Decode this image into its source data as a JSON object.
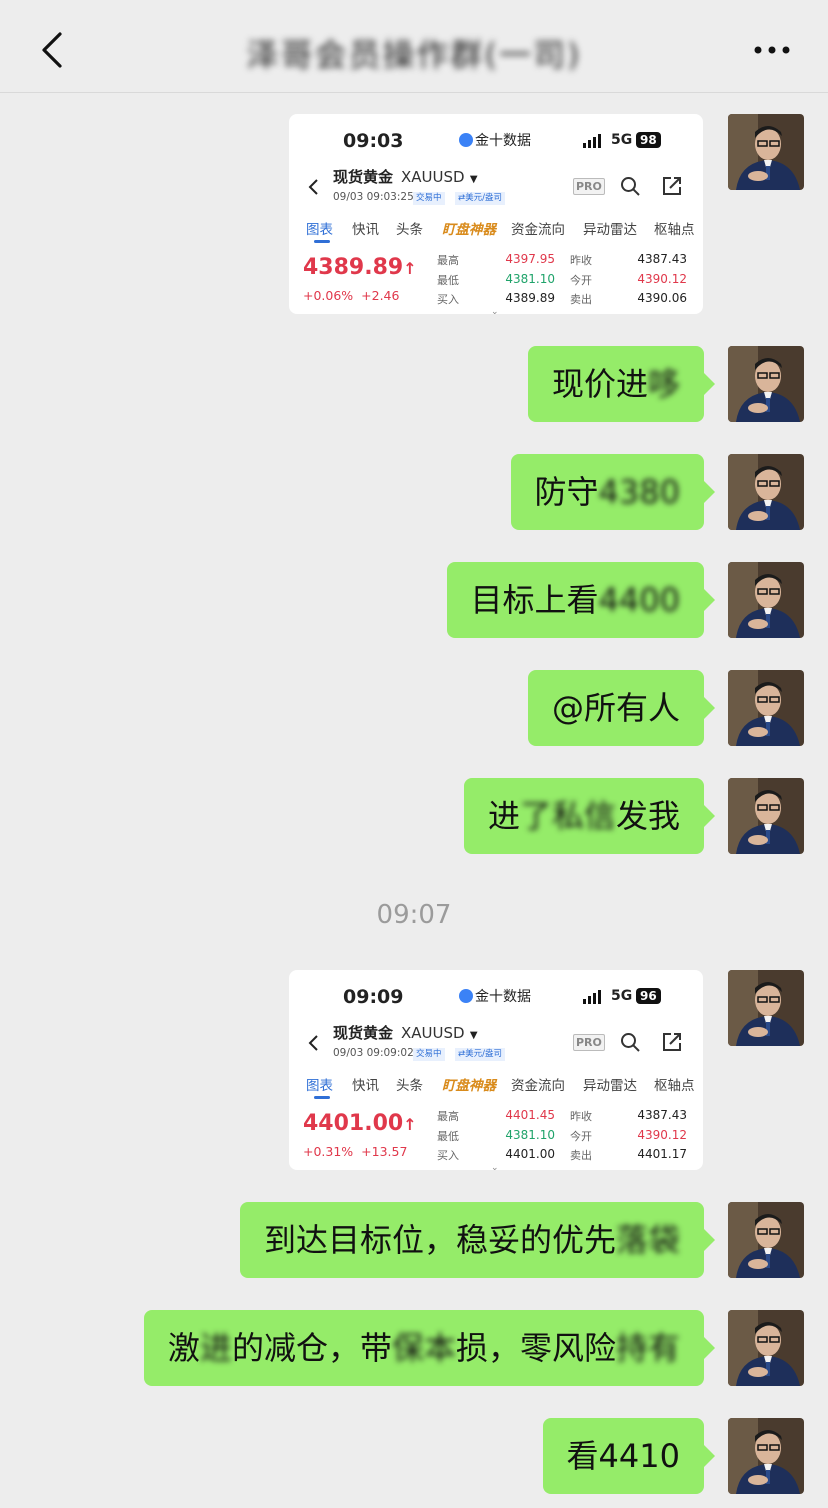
{
  "header": {
    "title": "泽哥会员操作群(一司)"
  },
  "screenshots": [
    {
      "time": "09:03",
      "brand": "金十数据",
      "network": "5G",
      "battery": "98",
      "name": "现货黄金",
      "symbol": "XAUUSD",
      "datetime": "09/03 09:03:25",
      "status_tag": "交易中",
      "currency_tag": "⇄美元/盎司",
      "pro": "PRO",
      "tabs": [
        "图表",
        "快讯",
        "头条",
        "盯盘神器",
        "资金流向",
        "异动雷达",
        "枢轴点"
      ],
      "price": "4389.89",
      "arrow": "↑",
      "change_pct": "+0.06%",
      "change": "+2.46",
      "stats": [
        {
          "label": "最高",
          "value": "4397.95",
          "color": "red"
        },
        {
          "label": "最低",
          "value": "4381.10",
          "color": "green"
        },
        {
          "label": "买入",
          "value": "4389.89",
          "color": "dark"
        },
        {
          "label": "昨收",
          "value": "4387.43",
          "color": "dark"
        },
        {
          "label": "今开",
          "value": "4390.12",
          "color": "red"
        },
        {
          "label": "卖出",
          "value": "4390.06",
          "color": "dark"
        }
      ]
    },
    {
      "time": "09:09",
      "brand": "金十数据",
      "network": "5G",
      "battery": "96",
      "name": "现货黄金",
      "symbol": "XAUUSD",
      "datetime": "09/03 09:09:02",
      "status_tag": "交易中",
      "currency_tag": "⇄美元/盎司",
      "pro": "PRO",
      "tabs": [
        "图表",
        "快讯",
        "头条",
        "盯盘神器",
        "资金流向",
        "异动雷达",
        "枢轴点"
      ],
      "price": "4401.00",
      "arrow": "↑",
      "change_pct": "+0.31%",
      "change": "+13.57",
      "stats": [
        {
          "label": "最高",
          "value": "4401.45",
          "color": "red"
        },
        {
          "label": "最低",
          "value": "4381.10",
          "color": "green"
        },
        {
          "label": "买入",
          "value": "4401.00",
          "color": "dark"
        },
        {
          "label": "昨收",
          "value": "4387.43",
          "color": "dark"
        },
        {
          "label": "今开",
          "value": "4390.12",
          "color": "red"
        },
        {
          "label": "卖出",
          "value": "4401.17",
          "color": "dark"
        }
      ]
    }
  ],
  "messages": [
    {
      "clear": "现价进",
      "blurred": "哆"
    },
    {
      "clear": "防守",
      "blurred": "4380"
    },
    {
      "clear": "目标上看",
      "blurred": "4400"
    },
    {
      "clear": "@所有人",
      "blurred": ""
    },
    {
      "clear": "进",
      "blurred": "了私信",
      "clear2": "发我"
    },
    {
      "clear": "到达目标位，稳妥的优先",
      "blurred": "落袋"
    },
    {
      "clear": "激",
      "blurred": "进",
      "clear2": "的减仓，带",
      "blurred2": "保本",
      "clear3": "损，零风险",
      "blurred3": "持有"
    },
    {
      "clear": "看4410",
      "blurred": ""
    }
  ],
  "timestamp": "09:07",
  "colors": {
    "bubble": "#95ec69",
    "background": "#ededed",
    "up": "#e0384b",
    "down": "#1fa36a",
    "accent": "#2f6fd6"
  }
}
